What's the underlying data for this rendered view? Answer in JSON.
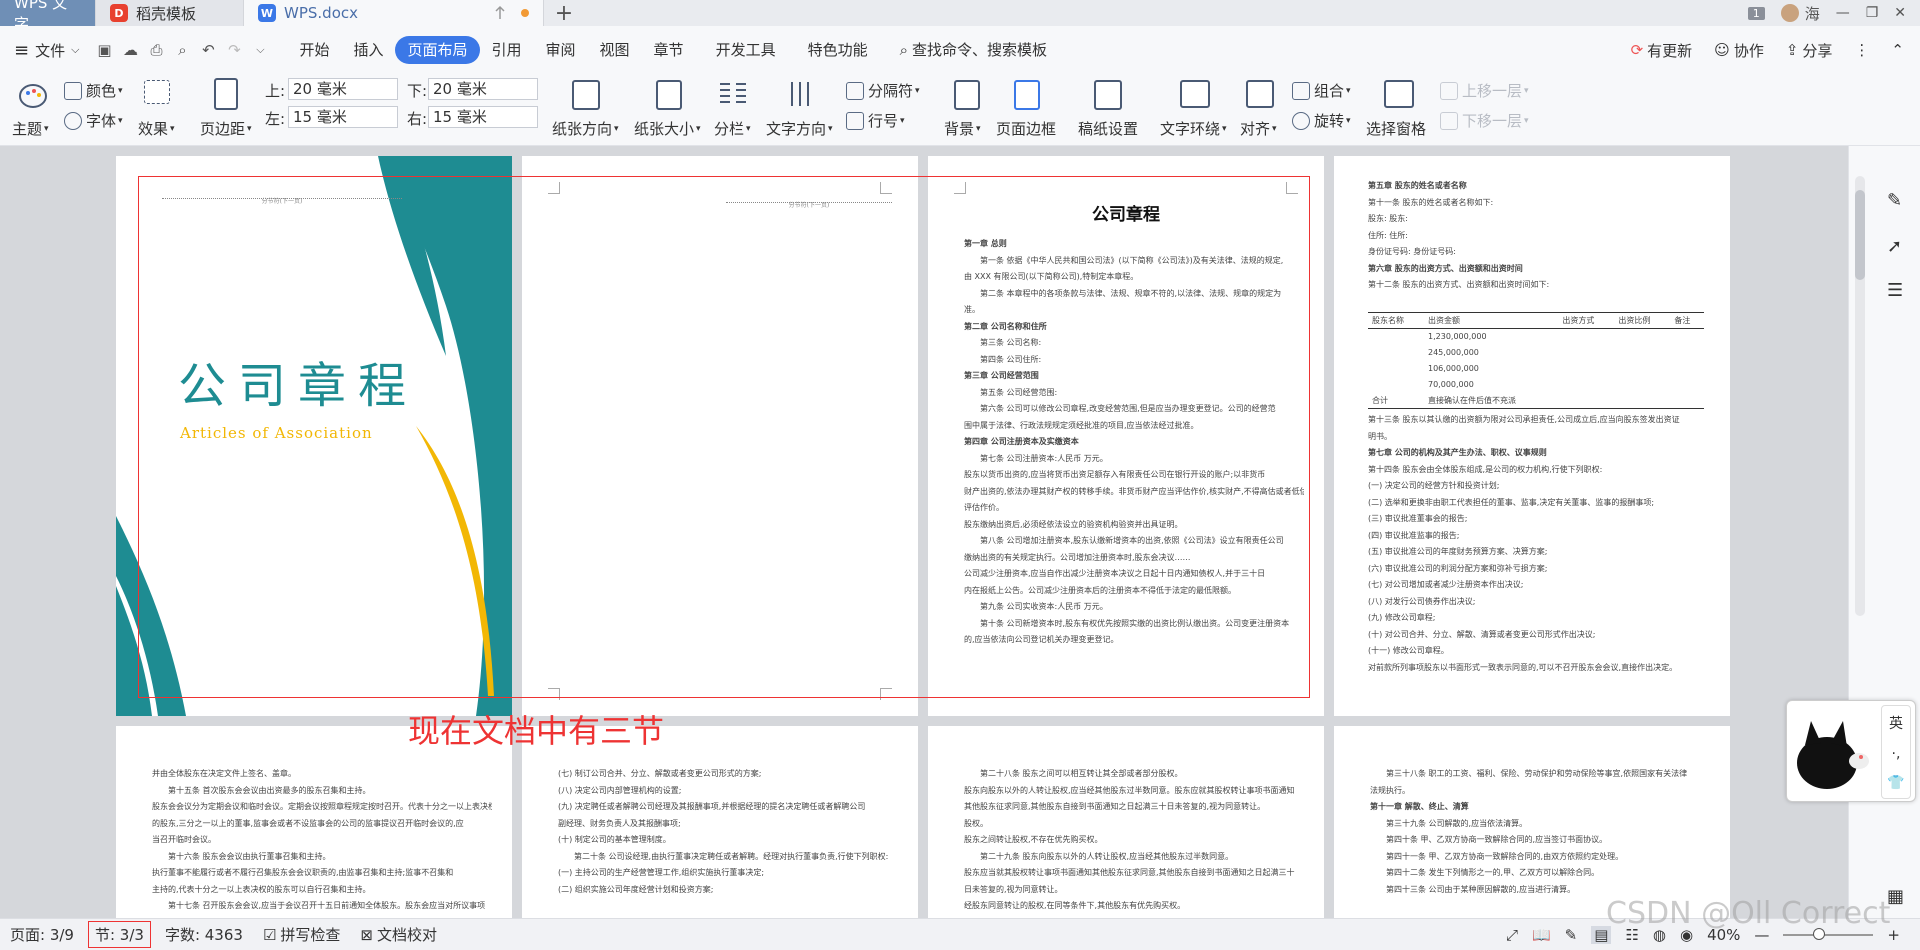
{
  "titlebar": {
    "app_tab": "WPS 文字",
    "template_tab": "稻壳模板",
    "doc_tab": "WPS.docx",
    "new_tab": "+",
    "user_badge": "1",
    "user_name": "海",
    "upload_icon": "upload-icon"
  },
  "menubar": {
    "file": "文件",
    "items": [
      "开始",
      "插入",
      "页面布局",
      "引用",
      "审阅",
      "视图",
      "章节",
      "开发工具",
      "特色功能"
    ],
    "active": "页面布局",
    "search": "查找命令、搜索模板",
    "update": "有更新",
    "collab": "协作",
    "share": "分享"
  },
  "ribbon": {
    "theme": "主题",
    "colors": "颜色",
    "font": "字体",
    "effects": "效果",
    "margins": "页边距",
    "top_label": "上:",
    "top_value": "20 毫米",
    "bottom_label": "下:",
    "bottom_value": "20 毫米",
    "left_label": "左:",
    "left_value": "15 毫米",
    "right_label": "右:",
    "right_value": "15 毫米",
    "orientation": "纸张方向",
    "size": "纸张大小",
    "columns": "分栏",
    "text_direction": "文字方向",
    "breaks": "分隔符",
    "line_numbers": "行号",
    "background": "背景",
    "page_border": "页面边框",
    "draft_paper": "稿纸设置",
    "wrap": "文字环绕",
    "align": "对齐",
    "rotate": "旋转",
    "group": "组合",
    "selection_pane": "选择窗格",
    "bring_forward": "上移一层",
    "send_backward": "下移一层"
  },
  "pages": {
    "cover": {
      "title": "公司章程",
      "subtitle": "Articles of Association",
      "header": "分节符(下一页)"
    },
    "p2": {
      "header": "分节符(下一页)"
    },
    "p3": {
      "title": "公司章程",
      "lines": [
        "第一章 总则",
        "第一条 依据《中华人民共和国公司法》(以下简称《公司法》)及有关法律、法规的规定,",
        "由 XXX 有限公司(以下简称公司),特制定本章程。",
        "第二条 本章程中的各项条款与法律、法规、规章不符的,以法律、法规、规章的规定为",
        "准。",
        "第二章 公司名称和住所",
        "第三条 公司名称:",
        "第四条 公司住所:",
        "第三章 公司经营范围",
        "第五条 公司经营范围:",
        "第六条 公司可以修改公司章程,改变经营范围,但是应当办理变更登记。公司的经营范",
        "围中属于法律、行政法规规定须经批准的项目,应当依法经过批准。",
        "第四章 公司注册资本及实缴资本",
        "第七条 公司注册资本:人民币 万元。",
        "股东以货币出资的,应当将货币出资足额存入有限责任公司在银行开设的账户;以非货币",
        "财产出资的,依法办理其财产权的转移手续。非货币财产应当评估作价,核实财产,不得高估或者低估作价。",
        "评估作价。",
        "股东缴纳出资后,必须经依法设立的验资机构验资并出具证明。",
        "第八条 公司增加注册资本,股东认缴新增资本的出资,依照《公司法》设立有限责任公司",
        "缴纳出资的有关规定执行。公司增加注册资本时,股东会决议……",
        "公司减少注册资本,应当自作出减少注册资本决议之日起十日内通知债权人,并于三十日",
        "内在报纸上公告。公司减少注册资本后的注册资本不得低于法定的最低限额。",
        "第九条 公司实收资本:人民币 万元。",
        "第十条 公司新增资本时,股东有权优先按照实缴的出资比例认缴出资。公司变更注册资本",
        "的,应当依法向公司登记机关办理变更登记。"
      ]
    },
    "p4": {
      "lines": [
        "第五章 股东的姓名或者名称",
        "第十一条 股东的姓名或者名称如下:",
        "股东:                      股东:",
        "住所:                      住所:",
        "身份证号码:                身份证号码:",
        "第六章 股东的出资方式、出资额和出资时间",
        "第十二条 股东的出资方式、出资额和出资时间如下:",
        "第十三条 股东以其认缴的出资额为限对公司承担责任,公司成立后,应当向股东签发出资证",
        "明书。",
        "第七章 公司的机构及其产生办法、职权、议事规则",
        "第十四条 股东会由全体股东组成,是公司的权力机构,行使下列职权:",
        "(一) 决定公司的经营方针和投资计划;",
        "(二) 选举和更换非由职工代表担任的董事、监事,决定有关董事、监事的报酬事项;",
        "(三) 审议批准董事会的报告;",
        "(四) 审议批准监事的报告;",
        "(五) 审议批准公司的年度财务预算方案、决算方案;",
        "(六) 审议批准公司的利润分配方案和弥补亏损方案;",
        "(七) 对公司增加或者减少注册资本作出决议;",
        "(八) 对发行公司债券作出决议;",
        "(九) 修改公司章程;",
        "(十) 对公司合并、分立、解散、清算或者变更公司形式作出决议;",
        "(十一) 修改公司章程。",
        "对前款所列事项股东以书面形式一致表示同意的,可以不召开股东会会议,直接作出决定。"
      ],
      "table_header": [
        "股东名称",
        "出资金额",
        "出资方式",
        "出资比例",
        "备注"
      ],
      "table_rows": [
        [
          "",
          "1,230,000,000",
          "",
          "",
          ""
        ],
        [
          "",
          "245,000,000",
          "",
          "",
          ""
        ],
        [
          "",
          "106,000,000",
          "",
          "",
          ""
        ],
        [
          "",
          "70,000,000",
          "",
          "",
          ""
        ],
        [
          "合计",
          "直接确认在件后值不充派",
          "",
          "",
          ""
        ]
      ]
    },
    "p5": {
      "lines": [
        "并由全体股东在决定文件上签名、盖章。",
        "第十五条 首次股东会会议由出资最多的股东召集和主持。",
        "股东会会议分为定期会议和临时会议。定期会议按照章程规定按时召开。代表十分之一以上表决权",
        "的股东,三分之一以上的董事,监事会或者不设监事会的公司的监事提议召开临时会议的,应",
        "当召开临时会议。",
        "第十六条 股东会会议由执行董事召集和主持。",
        "执行董事不能履行或者不履行召集股东会会议职责的,由监事召集和主持;监事不召集和",
        "主持的,代表十分之一以上表决权的股东可以自行召集和主持。",
        "第十七条 召开股东会会议,应当于会议召开十五日前通知全体股东。股东会应当对所议事项"
      ]
    },
    "p6": {
      "lines": [
        "(七) 制订公司合并、分立、解散或者变更公司形式的方案;",
        "(八) 决定公司内部管理机构的设置;",
        "(九) 决定聘任或者解聘公司经理及其报酬事项,并根据经理的提名决定聘任或者解聘公司",
        "副经理、财务负责人及其报酬事项;",
        "(十) 制定公司的基本管理制度。",
        "第二十条 公司设经理,由执行董事决定聘任或者解聘。经理对执行董事负责,行使下列职权:",
        "(一) 主持公司的生产经营管理工作,组织实施执行董事决定;",
        "(二) 组织实施公司年度经营计划和投资方案;"
      ]
    },
    "p7": {
      "lines": [
        "第二十八条 股东之间可以相互转让其全部或者部分股权。",
        "股东向股东以外的人转让股权,应当经其他股东过半数同意。股东应就其股权转让事项书面通知",
        "其他股东征求同意,其他股东自接到书面通知之日起满三十日未答复的,视为同意转让。",
        "股权。",
        "股东之间转让股权,不存在优先购买权。",
        "第二十九条 股东向股东以外的人转让股权,应当经其他股东过半数同意。",
        "股东应当就其股权转让事项书面通知其他股东征求同意,其他股东自接到书面通知之日起满三十",
        "日未答复的,视为同意转让。",
        "经股东同意转让的股权,在同等条件下,其他股东有优先购买权。"
      ]
    },
    "p8": {
      "lines": [
        "第三十八条 职工的工资、福利、保险、劳动保护和劳动保险等事宜,依照国家有关法律",
        "法规执行。",
        "第十一章 解散、终止、清算",
        "第三十九条 公司解散的,应当依法清算。",
        "第四十条 甲、乙双方协商一致解除合同的,应当签订书面协议。",
        "第四十一条 甲、乙双方协商一致解除合同的,由双方依照约定处理。",
        "第四十二条 发生下列情形之一的,甲、乙双方可以解除合同。",
        "第四十三条 公司由于某种原因解散的,应当进行清算。"
      ]
    }
  },
  "annotation": "现在文档中有三节",
  "status": {
    "page": "页面: 3/9",
    "section": "节: 3/3",
    "words": "字数: 4363",
    "spell": "拼写检查",
    "proof": "文档校对",
    "zoom": "40%"
  },
  "ime": {
    "lang": "英",
    "punct": "·,"
  },
  "watermark": "CSDN @Oll Correct",
  "colors": {
    "accent": "#3b78e7",
    "teal": "#1e8c92",
    "gold": "#f2b705",
    "annotation": "#e33333"
  }
}
